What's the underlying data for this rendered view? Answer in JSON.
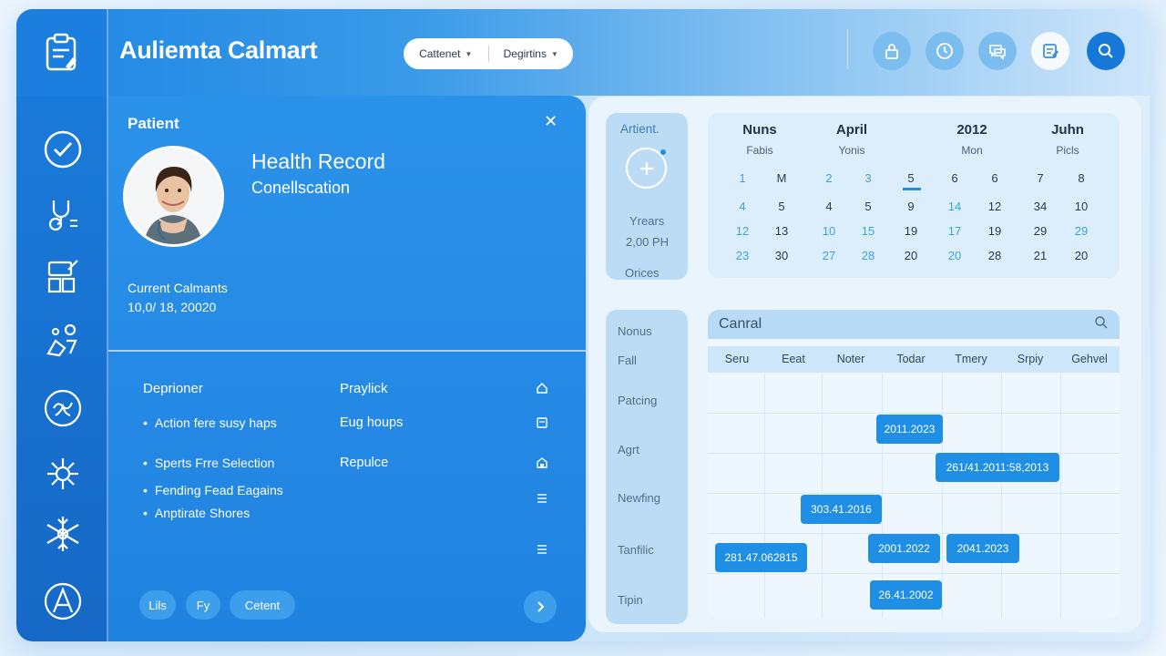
{
  "app": {
    "title": "Auliemta Calmart",
    "filters": [
      {
        "label": "Cattenet"
      },
      {
        "label": "Degirtins"
      }
    ],
    "top_icons": [
      "lock-icon",
      "clock-icon",
      "chat-icon",
      "document-icon",
      "search-icon"
    ]
  },
  "rail": {
    "icons": [
      "checkmark-icon",
      "stethoscope-icon",
      "clipboard-icon",
      "people-icon",
      "brain-icon",
      "virus-icon",
      "snowflake-icon",
      "atom-icon"
    ]
  },
  "patient": {
    "label": "Patient",
    "record_title": "Health Record",
    "record_subtitle": "Conellscation",
    "current_label": "Current Calmants",
    "current_date": "10,0/ 18, 20020",
    "col1_head": "Deprioner",
    "col2_head": "Praylick",
    "bullets": [
      "Action fere susy haps",
      "Sperts Frre Selection",
      "Fending Fead Eagains",
      "Anptirate Shores"
    ],
    "col2_items": [
      "Eug houps",
      "Repulce"
    ],
    "chips": [
      "Lils",
      "Fy",
      "Cetent"
    ]
  },
  "side_card": {
    "title": "Artient.",
    "line1": "Yrears",
    "line2": "2,00 PH",
    "line3": "Orices"
  },
  "calendar": {
    "headers": [
      {
        "title": "Nuns",
        "sub": "Fabis"
      },
      {
        "title": "April",
        "sub": "Yonis"
      },
      {
        "title": "2012",
        "sub": "Mon"
      },
      {
        "title": "Juhn",
        "sub": "Picls"
      }
    ],
    "rows": [
      [
        "1",
        "M",
        "2",
        "3",
        "5",
        "6",
        "6",
        "7",
        "8"
      ],
      [
        "4",
        "5",
        "4",
        "5",
        "9",
        "14",
        "12",
        "34",
        "10"
      ],
      [
        "12",
        "13",
        "10",
        "15",
        "19",
        "17",
        "19",
        "29",
        "29"
      ],
      [
        "23",
        "30",
        "27",
        "28",
        "20",
        "20",
        "28",
        "21",
        "20"
      ]
    ],
    "light_mask": [
      [
        1,
        0,
        1,
        1,
        0,
        0,
        0,
        0,
        0
      ],
      [
        1,
        0,
        0,
        0,
        0,
        1,
        0,
        0,
        0
      ],
      [
        1,
        0,
        1,
        1,
        0,
        1,
        0,
        0,
        1
      ],
      [
        1,
        0,
        1,
        1,
        0,
        1,
        0,
        0,
        0
      ]
    ]
  },
  "side_list": {
    "items": [
      "Nonus",
      "Fall",
      "Patcing",
      "Agrt",
      "Newfing",
      "Tanfilic",
      "Tipin"
    ]
  },
  "schedule": {
    "title": "Canral",
    "columns": [
      "Seru",
      "Eeat",
      "Noter",
      "Todar",
      "Tmery",
      "Srpiy",
      "Gehvel"
    ],
    "events": [
      "2011.2023",
      "261/41.2011:58,2013",
      "303.41.2016",
      "281.47.062815",
      "2001.2022",
      "2041.2023",
      "26.41.2002"
    ]
  }
}
